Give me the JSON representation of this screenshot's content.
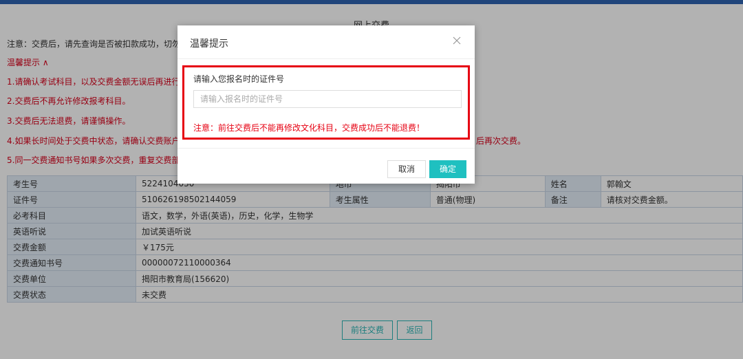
{
  "page": {
    "title": "网上交费",
    "notice": "注意：交费后，请先查询是否被扣款成功，切勿",
    "tips_toggle": "温馨提示 ∧",
    "tips": [
      "1.请确认考试科目，以及交费金额无误后再进行交",
      "2.交费后不再允许修改报考科目。",
      "3.交费后无法退费，请谨慎操作。",
      "4.如果长时间处于交费中状态，请确认交费账户是",
      "5.同一交费通知书号如果多次交费，重复交费部分"
    ],
    "tip4_tail": "后再次交费。"
  },
  "table": {
    "row1": {
      "label": "考生号",
      "value": "5224104030",
      "label2": "地市",
      "value2": "揭阳市",
      "label3": "姓名",
      "value3": "郭翰文"
    },
    "row2": {
      "label": "证件号",
      "value": "510626198502144059",
      "label2": "考生属性",
      "value2": "普通(物理)",
      "label3": "备注",
      "value3": "请核对交费金额。"
    },
    "rows": [
      {
        "label": "必考科目",
        "value": "语文，数学，外语(英语)，历史，化学，生物学"
      },
      {
        "label": "英语听说",
        "value": "加试英语听说"
      },
      {
        "label": "交费金额",
        "value": "￥175元"
      },
      {
        "label": "交费通知书号",
        "value": "00000072110000364"
      },
      {
        "label": "交费单位",
        "value": "揭阳市教育局(156620)"
      },
      {
        "label": "交费状态",
        "value": "未交费"
      }
    ]
  },
  "actions": {
    "go_pay": "前往交费",
    "back": "返回"
  },
  "modal": {
    "title": "温馨提示",
    "field_label": "请输入您报名时的证件号",
    "input_placeholder": "请输入报名时的证件号",
    "input_value": "",
    "warning": "注意：前往交费后不能再修改文化科目，交费成功后不能退费！",
    "cancel": "取消",
    "ok": "确定"
  },
  "colors": {
    "topbar": "#2e63b0",
    "accent": "#1fc0c0",
    "danger": "#e60012",
    "tip_red": "#d9001b",
    "label_bg": "#e4eef8"
  },
  "icons": {
    "close": "close-icon"
  }
}
